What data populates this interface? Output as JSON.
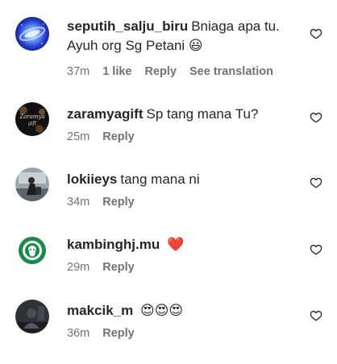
{
  "comments": [
    {
      "username": "seputih_salju_biru",
      "text": "Bniaga apa tu. Ayuh org Sg Petani",
      "emoji": "😃",
      "time": "37m",
      "likes": "1 like",
      "reply": "Reply",
      "translate": "See translation"
    },
    {
      "username": "zaramyagift",
      "text": "Sp tang mana Tu?",
      "emoji": "",
      "time": "25m",
      "reply": "Reply"
    },
    {
      "username": "lokiieys",
      "text": "tang mana ni",
      "emoji": "",
      "time": "34m",
      "reply": "Reply"
    },
    {
      "username": "kambinghj.mu",
      "text": "",
      "emoji": "❤️",
      "time": "29m",
      "reply": "Reply"
    },
    {
      "username": "makcik_m",
      "text": "",
      "emoji": "😍😍😍",
      "time": "36m",
      "reply": "Reply"
    }
  ],
  "colors": {
    "text": "#262626",
    "secondary": "#737373",
    "heart": "#ed4956"
  },
  "icons": {
    "like": "heart-outline-icon"
  }
}
